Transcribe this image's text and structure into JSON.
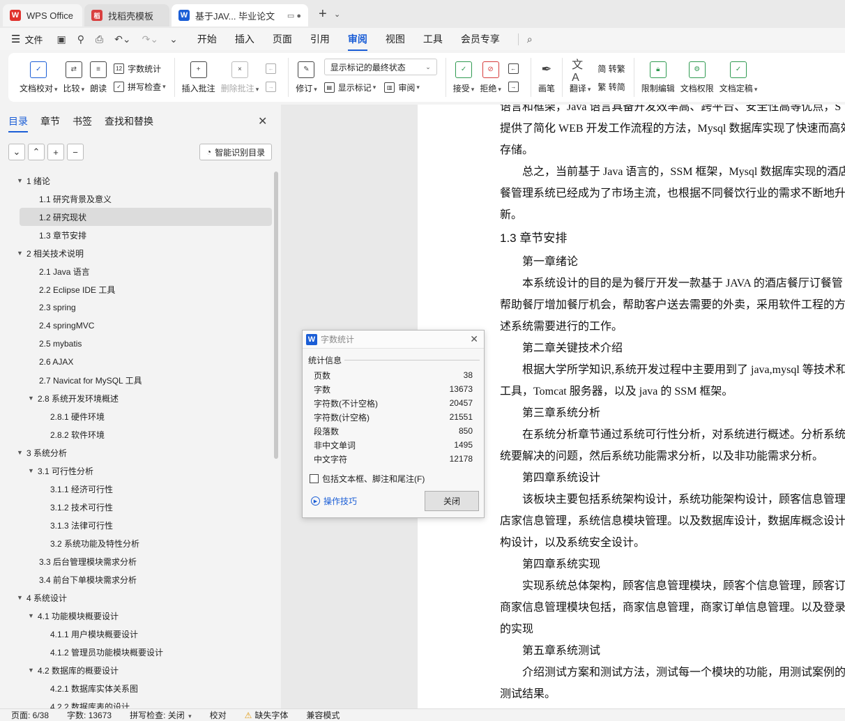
{
  "tabs": [
    {
      "label": "WPS Office",
      "logo": "W"
    },
    {
      "label": "找稻壳模板",
      "logo": "稻"
    },
    {
      "label": "基于JAV... 毕业论文",
      "logo": "W"
    }
  ],
  "menu": {
    "file": "文件",
    "items": [
      "开始",
      "插入",
      "页面",
      "引用",
      "审阅",
      "视图",
      "工具",
      "会员专享"
    ],
    "active": "审阅"
  },
  "ribbon": {
    "doc_check": "文档校对",
    "compare": "比较",
    "read_aloud": "朗读",
    "word_count": "字数统计",
    "spell_check": "拼写检查",
    "insert_comment": "插入批注",
    "delete_comment": "删除批注",
    "revise": "修订",
    "show_state": "显示标记的最终状态",
    "show_marks": "显示标记",
    "review": "审阅",
    "accept": "接受",
    "reject": "拒绝",
    "pen": "画笔",
    "translate": "翻译",
    "to_traditional": "简 转繁",
    "to_simplified": "繁 转简",
    "restrict_edit": "限制编辑",
    "doc_permission": "文档权限",
    "doc_finalize": "文档定稿"
  },
  "nav": {
    "tabs": [
      "目录",
      "章节",
      "书签",
      "查找和替换"
    ],
    "active_tab": "目录",
    "smart_toc": "智能识别目录",
    "toc": [
      {
        "label": "1  绪论",
        "level": 1,
        "expanded": true
      },
      {
        "label": "1.1 研究背景及意义",
        "level": 2
      },
      {
        "label": "1.2 研究现状",
        "level": 2,
        "selected": true
      },
      {
        "label": "1.3 章节安排",
        "level": 2
      },
      {
        "label": "2  相关技术说明",
        "level": 1,
        "expanded": true
      },
      {
        "label": "2.1 Java 语言",
        "level": 2
      },
      {
        "label": "2.2 Eclipse IDE 工具",
        "level": 2
      },
      {
        "label": "2.3 spring",
        "level": 2
      },
      {
        "label": "2.4 springMVC",
        "level": 2
      },
      {
        "label": "2.5 mybatis",
        "level": 2
      },
      {
        "label": "2.6 AJAX",
        "level": 2
      },
      {
        "label": "2.7 Navicat for MySQL 工具",
        "level": 2
      },
      {
        "label": "2.8 系统开发环境概述",
        "level": 2,
        "expanded": true
      },
      {
        "label": "2.8.1 硬件环境",
        "level": 3
      },
      {
        "label": "2.8.2 软件环境",
        "level": 3
      },
      {
        "label": "3  系统分析",
        "level": 1,
        "expanded": true
      },
      {
        "label": "3.1 可行性分析",
        "level": 2,
        "expanded": true
      },
      {
        "label": "3.1.1 经济可行性",
        "level": 3
      },
      {
        "label": "3.1.2 技术可行性",
        "level": 3
      },
      {
        "label": "3.1.3 法律可行性",
        "level": 3
      },
      {
        "label": "3.2 系统功能及特性分析",
        "level": 3
      },
      {
        "label": "3.3 后台管理模块需求分析",
        "level": 2
      },
      {
        "label": "3.4 前台下单模块需求分析",
        "level": 2
      },
      {
        "label": "4  系统设计",
        "level": 1,
        "expanded": true
      },
      {
        "label": "4.1 功能模块概要设计",
        "level": 2,
        "expanded": true
      },
      {
        "label": "4.1.1 用户模块概要设计",
        "level": 3
      },
      {
        "label": "4.1.2 管理员功能模块概要设计",
        "level": 3
      },
      {
        "label": "4.2 数据库的概要设计",
        "level": 2,
        "expanded": true
      },
      {
        "label": "4.2.1 数据库实体关系图",
        "level": 3
      },
      {
        "label": "4.2.2 数据库表的设计",
        "level": 3
      }
    ]
  },
  "document": {
    "lines": [
      {
        "text": "语言和框架，Java 语言具备开发效率高、跨平台、安全性高等优点，S",
        "type": "body"
      },
      {
        "text": "提供了简化 WEB 开发工作流程的方法，Mysql 数据库实现了快速而高效",
        "type": "body"
      },
      {
        "text": "存储。",
        "type": "body"
      },
      {
        "text": "总之，当前基于 Java 语言的，SSM 框架，Mysql 数据库实现的酒店",
        "type": "indent"
      },
      {
        "text": "餐管理系统已经成为了市场主流，也根据不同餐饮行业的需求不断地升",
        "type": "body"
      },
      {
        "text": "新。",
        "type": "body"
      },
      {
        "text": "1.3 章节安排",
        "type": "h2"
      },
      {
        "text": "第一章绪论",
        "type": "indent"
      },
      {
        "text": "本系统设计的目的是为餐厅开发一款基于 JAVA 的酒店餐厅订餐管",
        "type": "indent"
      },
      {
        "text": "帮助餐厅增加餐厅机会，帮助客户送去需要的外卖，采用软件工程的方法",
        "type": "body"
      },
      {
        "text": "述系统需要进行的工作。",
        "type": "body"
      },
      {
        "text": "第二章关键技术介绍",
        "type": "indent"
      },
      {
        "text": "根据大学所学知识,系统开发过程中主要用到了 java,mysql 等技术和",
        "type": "indent"
      },
      {
        "text": "工具，Tomcat 服务器，以及 java 的 SSM 框架。",
        "type": "body"
      },
      {
        "text": "第三章系统分析",
        "type": "indent"
      },
      {
        "text": "在系统分析章节通过系统可行性分析，对系统进行概述。分析系统图",
        "type": "indent"
      },
      {
        "text": "统要解决的问题，然后系统功能需求分析，以及非功能需求分析。",
        "type": "body"
      },
      {
        "text": "第四章系统设计",
        "type": "indent"
      },
      {
        "text": "该板块主要包括系统架构设计，系统功能架构设计，顾客信息管理",
        "type": "indent"
      },
      {
        "text": "店家信息管理，系统信息模块管理。以及数据库设计，数据库概念设计，",
        "type": "body"
      },
      {
        "text": "构设计，以及系统安全设计。",
        "type": "body"
      },
      {
        "text": "第四章系统实现",
        "type": "indent"
      },
      {
        "text": "实现系统总体架构，顾客信息管理模块，顾客个信息管理，顾客订",
        "type": "indent"
      },
      {
        "text": "商家信息管理模块包括，商家信息管理，商家订单信息管理。以及登录",
        "type": "body"
      },
      {
        "text": "的实现",
        "type": "body"
      },
      {
        "text": "第五章系统测试",
        "type": "indent"
      },
      {
        "text": "介绍测试方案和测试方法，测试每一个模块的功能，用测试案例的方",
        "type": "indent"
      },
      {
        "text": "测试结果。",
        "type": "body"
      }
    ]
  },
  "dialog": {
    "title": "字数统计",
    "section": "统计信息",
    "stats": [
      {
        "label": "页数",
        "value": "38"
      },
      {
        "label": "字数",
        "value": "13673"
      },
      {
        "label": "字符数(不计空格)",
        "value": "20457"
      },
      {
        "label": "字符数(计空格)",
        "value": "21551"
      },
      {
        "label": "段落数",
        "value": "850"
      },
      {
        "label": "非中文单词",
        "value": "1495"
      },
      {
        "label": "中文字符",
        "value": "12178"
      }
    ],
    "checkbox": "包括文本框、脚注和尾注(F)",
    "tips": "操作技巧",
    "close": "关闭"
  },
  "status": {
    "page": "页面: 6/38",
    "words": "字数: 13673",
    "spell": "拼写检查: 关闭",
    "proof": "校对",
    "missing_font": "缺失字体",
    "compat": "兼容模式"
  },
  "colors": {
    "accent": "#1b5ed6",
    "wps_red": "#e0322d",
    "dao_red": "#d94040"
  }
}
